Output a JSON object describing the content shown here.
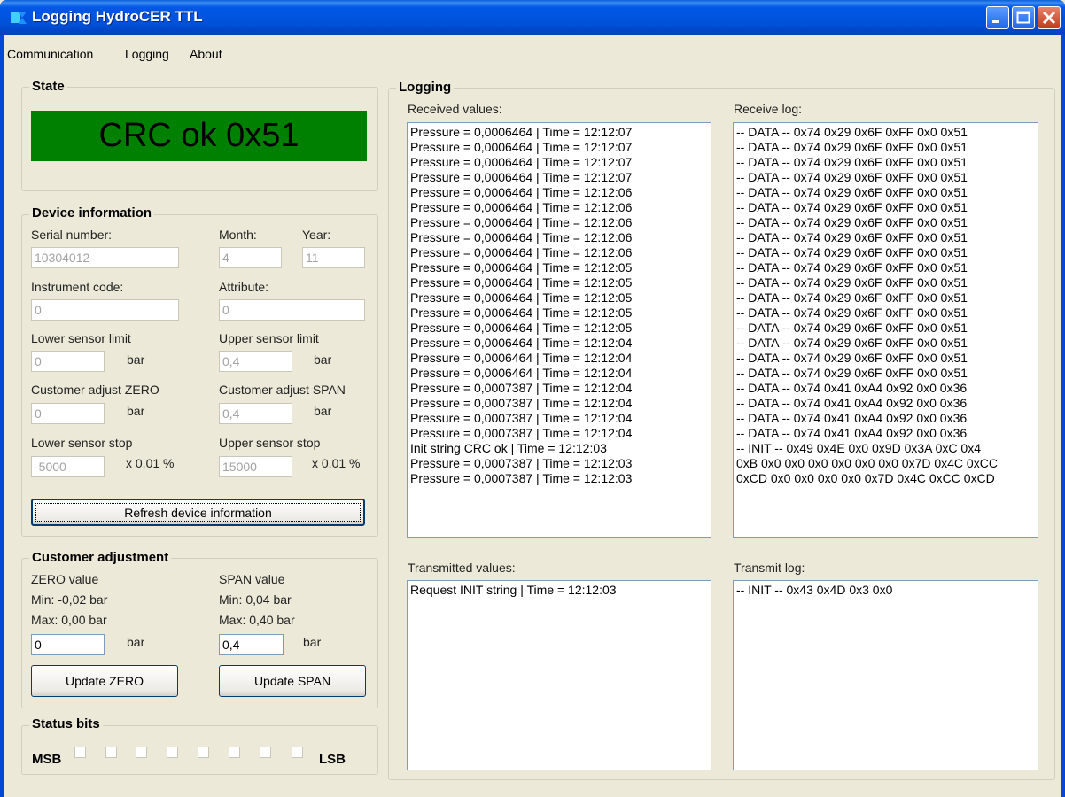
{
  "window": {
    "title": "Logging HydroCER TTL"
  },
  "menu": [
    "Communication",
    "Logging",
    "About"
  ],
  "state": {
    "legend": "State",
    "display_text": "CRC ok 0x51",
    "display_color": "#008000"
  },
  "device_info": {
    "legend": "Device information",
    "serial_label": "Serial number:",
    "serial_value": "10304012",
    "month_label": "Month:",
    "month_value": "4",
    "year_label": "Year:",
    "year_value": "11",
    "instrument_label": "Instrument code:",
    "instrument_value": "0",
    "attribute_label": "Attribute:",
    "attribute_value": "0",
    "lower_limit_label": "Lower sensor limit",
    "lower_limit_value": "0",
    "upper_limit_label": "Upper sensor limit",
    "upper_limit_value": "0,4",
    "adj_zero_label": "Customer adjust ZERO",
    "adj_zero_value": "0",
    "adj_span_label": "Customer adjust SPAN",
    "adj_span_value": "0,4",
    "lower_stop_label": "Lower sensor stop",
    "lower_stop_value": "-5000",
    "upper_stop_label": "Upper sensor stop",
    "upper_stop_value": "15000",
    "unit_bar": "bar",
    "unit_pct": "x 0.01 %",
    "refresh_button": "Refresh device information"
  },
  "customer_adjustment": {
    "legend": "Customer adjustment",
    "zero_title": "ZERO value",
    "zero_min": "Min: -0,02 bar",
    "zero_max": "Max: 0,00 bar",
    "zero_value": "0",
    "span_title": "SPAN value",
    "span_min": "Min: 0,04 bar",
    "span_max": "Max: 0,40 bar",
    "span_value": "0,4",
    "unit_bar": "bar",
    "update_zero": "Update ZERO",
    "update_span": "Update SPAN"
  },
  "status_bits": {
    "legend": "Status bits",
    "msb": "MSB",
    "lsb": "LSB"
  },
  "logging": {
    "legend": "Logging",
    "received_label": "Received values:",
    "received": [
      "Pressure = 0,0006464 | Time = 12:12:07",
      "Pressure = 0,0006464 | Time = 12:12:07",
      "Pressure = 0,0006464 | Time = 12:12:07",
      "Pressure = 0,0006464 | Time = 12:12:07",
      "Pressure = 0,0006464 | Time = 12:12:06",
      "Pressure = 0,0006464 | Time = 12:12:06",
      "Pressure = 0,0006464 | Time = 12:12:06",
      "Pressure = 0,0006464 | Time = 12:12:06",
      "Pressure = 0,0006464 | Time = 12:12:06",
      "Pressure = 0,0006464 | Time = 12:12:05",
      "Pressure = 0,0006464 | Time = 12:12:05",
      "Pressure = 0,0006464 | Time = 12:12:05",
      "Pressure = 0,0006464 | Time = 12:12:05",
      "Pressure = 0,0006464 | Time = 12:12:05",
      "Pressure = 0,0006464 | Time = 12:12:04",
      "Pressure = 0,0006464 | Time = 12:12:04",
      "Pressure = 0,0006464 | Time = 12:12:04",
      "Pressure = 0,0007387 | Time = 12:12:04",
      "Pressure = 0,0007387 | Time = 12:12:04",
      "Pressure = 0,0007387 | Time = 12:12:04",
      "Pressure = 0,0007387 | Time = 12:12:04",
      "Init string CRC ok | Time = 12:12:03",
      "Pressure = 0,0007387 | Time = 12:12:03",
      "Pressure = 0,0007387 | Time = 12:12:03"
    ],
    "receive_log_label": "Receive log:",
    "receive_log": [
      "-- DATA -- 0x74 0x29 0x6F 0xFF 0x0 0x51",
      "-- DATA -- 0x74 0x29 0x6F 0xFF 0x0 0x51",
      "-- DATA -- 0x74 0x29 0x6F 0xFF 0x0 0x51",
      "-- DATA -- 0x74 0x29 0x6F 0xFF 0x0 0x51",
      "-- DATA -- 0x74 0x29 0x6F 0xFF 0x0 0x51",
      "-- DATA -- 0x74 0x29 0x6F 0xFF 0x0 0x51",
      "-- DATA -- 0x74 0x29 0x6F 0xFF 0x0 0x51",
      "-- DATA -- 0x74 0x29 0x6F 0xFF 0x0 0x51",
      "-- DATA -- 0x74 0x29 0x6F 0xFF 0x0 0x51",
      "-- DATA -- 0x74 0x29 0x6F 0xFF 0x0 0x51",
      "-- DATA -- 0x74 0x29 0x6F 0xFF 0x0 0x51",
      "-- DATA -- 0x74 0x29 0x6F 0xFF 0x0 0x51",
      "-- DATA -- 0x74 0x29 0x6F 0xFF 0x0 0x51",
      "-- DATA -- 0x74 0x29 0x6F 0xFF 0x0 0x51",
      "-- DATA -- 0x74 0x29 0x6F 0xFF 0x0 0x51",
      "-- DATA -- 0x74 0x29 0x6F 0xFF 0x0 0x51",
      "-- DATA -- 0x74 0x29 0x6F 0xFF 0x0 0x51",
      "-- DATA -- 0x74 0x41 0xA4 0x92 0x0 0x36",
      "-- DATA -- 0x74 0x41 0xA4 0x92 0x0 0x36",
      "-- DATA -- 0x74 0x41 0xA4 0x92 0x0 0x36",
      "-- DATA -- 0x74 0x41 0xA4 0x92 0x0 0x36",
      "-- INIT -- 0x49 0x4E 0x0 0x9D 0x3A 0xC 0x4",
      "0xB 0x0 0x0 0x0 0x0 0x0 0x0 0x7D 0x4C 0xCC",
      "0xCD 0x0 0x0 0x0 0x0 0x7D 0x4C 0xCC 0xCD"
    ],
    "transmitted_label": "Transmitted values:",
    "transmitted": [
      "Request INIT string | Time = 12:12:03"
    ],
    "transmit_log_label": "Transmit log:",
    "transmit_log": [
      "-- INIT -- 0x43 0x4D 0x3 0x0"
    ]
  },
  "icons": {
    "app": "app-icon",
    "minimize": "minimize-icon",
    "maximize": "maximize-icon",
    "close": "close-icon"
  }
}
